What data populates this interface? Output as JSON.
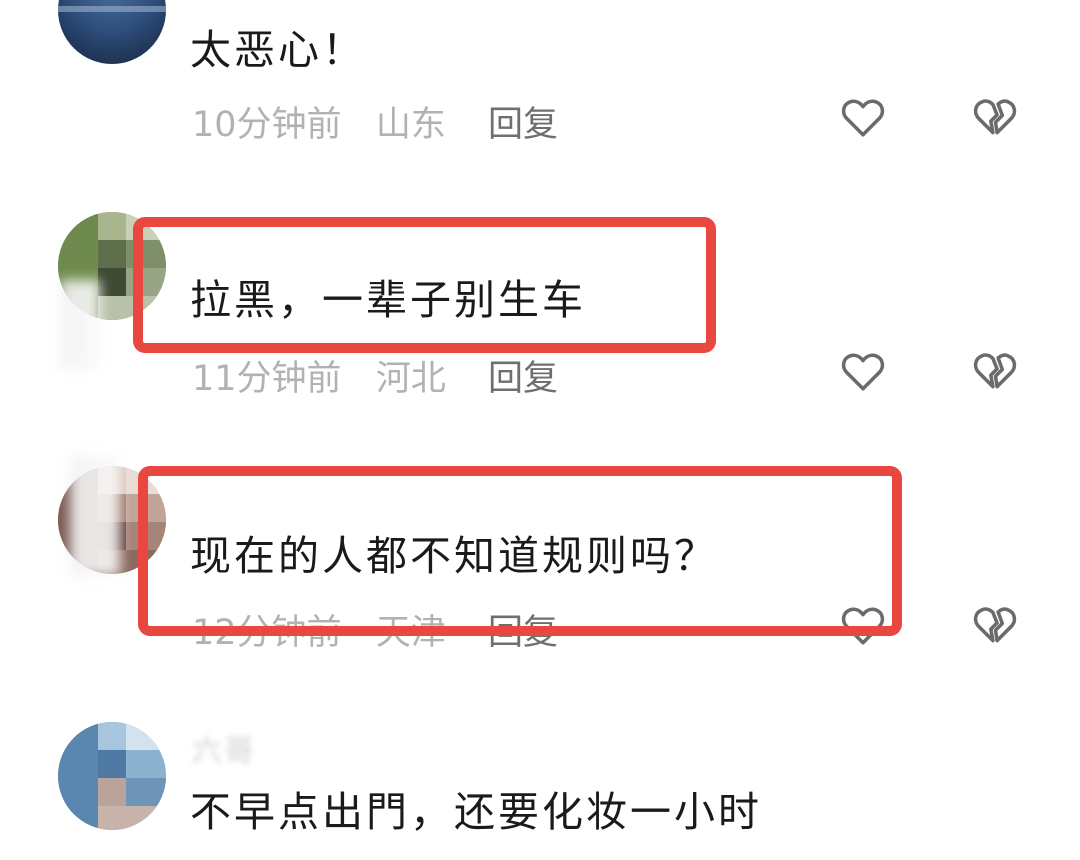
{
  "comments": [
    {
      "username": "",
      "text": "太恶心！",
      "time": "10分钟前",
      "location": "山东",
      "reply_label": "回复"
    },
    {
      "username": "",
      "text": "拉黑，一辈子别生车",
      "time": "11分钟前",
      "location": "河北",
      "reply_label": "回复"
    },
    {
      "username": "",
      "text": "现在的人都不知道规则吗？",
      "time": "12分钟前",
      "location": "天津",
      "reply_label": "回复"
    },
    {
      "username": "六哥",
      "text": "不早点出門，还要化妆一小时",
      "time": "",
      "location": "",
      "reply_label": ""
    }
  ],
  "icons": {
    "like": "heart-outline-icon",
    "dislike": "broken-heart-icon"
  },
  "colors": {
    "highlight_box": "#e8483f",
    "comment_text": "#1a1a1a",
    "meta_text": "#b2b2b2",
    "reply_text": "#6f6f6f",
    "icon_stroke": "#6b6b6b"
  }
}
